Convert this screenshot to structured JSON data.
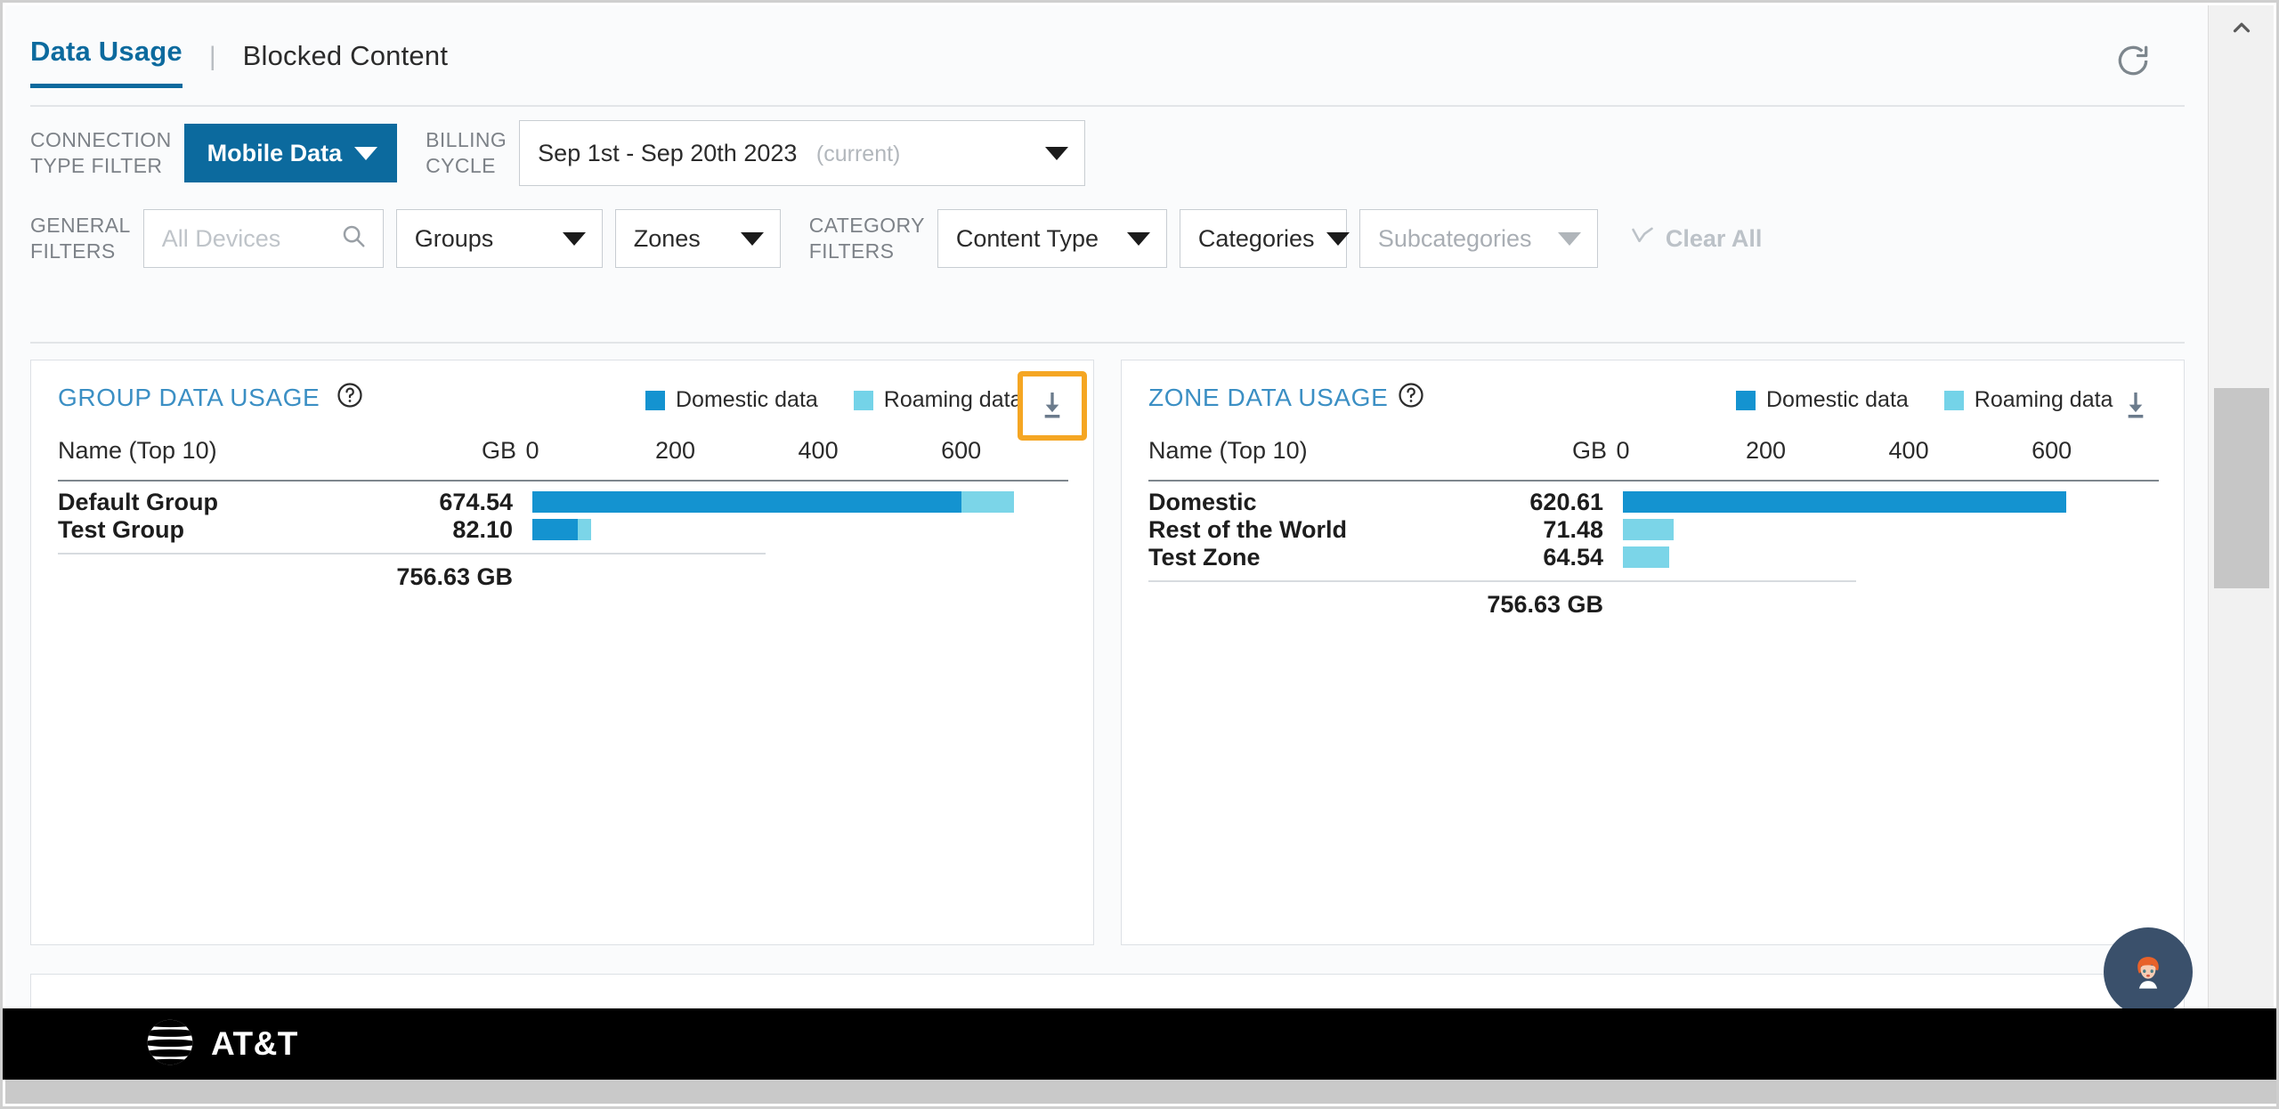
{
  "tabs": {
    "items": [
      {
        "label": "Data Usage",
        "active": true
      },
      {
        "label": "Blocked Content",
        "active": false
      }
    ],
    "separator": "|",
    "refresh_icon": "refresh-icon"
  },
  "filters": {
    "connection_type": {
      "label": "CONNECTION\nTYPE FILTER",
      "value": "Mobile Data"
    },
    "billing_cycle": {
      "label": "BILLING\nCYCLE",
      "value": "Sep 1st - Sep 20th 2023",
      "suffix": "(current)"
    },
    "general": {
      "label": "GENERAL\nFILTERS",
      "device_search_placeholder": "All Devices",
      "device_search_value": "",
      "groups": "Groups",
      "zones": "Zones"
    },
    "category": {
      "label": "CATEGORY\nFILTERS",
      "content_type": "Content Type",
      "categories": "Categories",
      "subcategories": "Subcategories"
    },
    "clear_all": "Clear All"
  },
  "colors": {
    "accent_blue": "#0c6a9e",
    "title_blue": "#3b8fc4",
    "domestic": "#1493d0",
    "roaming": "#7bd5e8",
    "highlight_orange": "#f5a623",
    "footer_black": "#000000"
  },
  "chart_data": [
    {
      "type": "bar",
      "title": "GROUP DATA USAGE",
      "panel": "group",
      "col_name_header": "Name (Top 10)",
      "col_value_header": "GB",
      "legend": [
        {
          "name": "Domestic data",
          "color": "#1493d0"
        },
        {
          "name": "Roaming data",
          "color": "#7bd5e8"
        }
      ],
      "xlabel": "",
      "ylabel": "",
      "xlim": [
        0,
        750
      ],
      "ticks": [
        0,
        200,
        400,
        600
      ],
      "stacked": true,
      "categories": [
        "Default Group",
        "Test Group"
      ],
      "value_labels": [
        "674.54",
        "82.10"
      ],
      "series": [
        {
          "name": "Domestic data",
          "values": [
            600.0,
            64.0
          ]
        },
        {
          "name": "Roaming data",
          "values": [
            74.54,
            18.1
          ]
        }
      ],
      "total_label": "756.63 GB",
      "download_icon": "download-icon",
      "help_icon": "help-circle-icon",
      "download_highlighted": true
    },
    {
      "type": "bar",
      "title": "ZONE DATA USAGE",
      "panel": "zone",
      "col_name_header": "Name (Top 10)",
      "col_value_header": "GB",
      "legend": [
        {
          "name": "Domestic data",
          "color": "#1493d0"
        },
        {
          "name": "Roaming data",
          "color": "#7bd5e8"
        }
      ],
      "xlabel": "",
      "ylabel": "",
      "xlim": [
        0,
        750
      ],
      "ticks": [
        0,
        200,
        400,
        600
      ],
      "stacked": false,
      "categories": [
        "Domestic",
        "Rest of the World",
        "Test Zone"
      ],
      "value_labels": [
        "620.61",
        "71.48",
        "64.54"
      ],
      "series": [
        {
          "name": "Domestic data",
          "values": [
            620.61,
            0,
            0
          ]
        },
        {
          "name": "Roaming data",
          "values": [
            0,
            71.48,
            64.54
          ]
        }
      ],
      "total_label": "756.63 GB",
      "download_icon": "download-icon",
      "help_icon": "help-circle-icon",
      "download_highlighted": false
    }
  ],
  "assistant": {
    "icon": "avatar-icon"
  },
  "footer": {
    "brand": "AT&T",
    "logo_icon": "att-globe-icon"
  },
  "scrollbar": {
    "up_icon": "chevron-up-icon",
    "down_icon": "chevron-down-icon"
  }
}
